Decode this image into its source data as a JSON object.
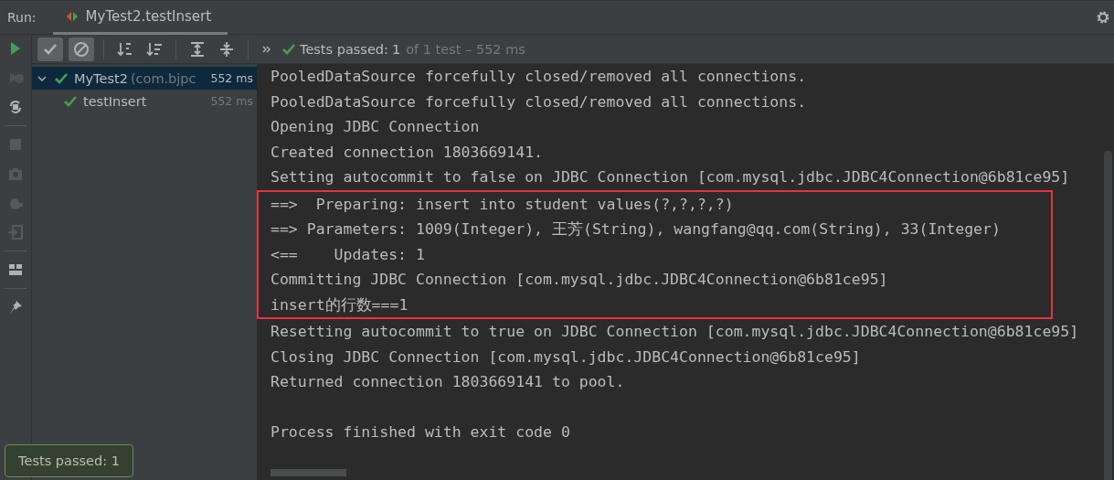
{
  "run_label": "Run:",
  "tab": {
    "title": "MyTest2.testInsert",
    "selected": true
  },
  "toolbar": {
    "toggles": [
      {
        "kind": "passed",
        "selected": true
      },
      {
        "kind": "ignored",
        "selected": true
      }
    ]
  },
  "status": {
    "label": "Tests passed:",
    "count": "1",
    "detail": "of 1 test – 552 ms",
    "passed": true
  },
  "tree": [
    {
      "name": "MyTest2",
      "package": "(com.bjpc",
      "time": "552 ms",
      "selected": true,
      "expanded": true,
      "passed": true,
      "children": [
        {
          "name": "testInsert",
          "time": "552 ms",
          "selected": false,
          "passed": true
        }
      ]
    }
  ],
  "console": [
    {
      "text": "PooledDataSource forcefully closed/removed all connections.",
      "highlighted": false
    },
    {
      "text": "PooledDataSource forcefully closed/removed all connections.",
      "highlighted": false
    },
    {
      "text": "Opening JDBC Connection",
      "highlighted": false
    },
    {
      "text": "Created connection 1803669141.",
      "highlighted": false
    },
    {
      "text": "Setting autocommit to false on JDBC Connection [com.mysql.jdbc.JDBC4Connection@6b81ce95]",
      "highlighted": false
    },
    {
      "text": "==>  Preparing: insert into student values(?,?,?,?)",
      "highlighted": true
    },
    {
      "text": "==> Parameters: 1009(Integer), 王芳(String), wangfang@qq.com(String), 33(Integer)",
      "highlighted": true
    },
    {
      "text": "<==    Updates: 1",
      "highlighted": true
    },
    {
      "text": "Committing JDBC Connection [com.mysql.jdbc.JDBC4Connection@6b81ce95]",
      "highlighted": true
    },
    {
      "text": "insert的行数===1",
      "highlighted": true
    },
    {
      "text": "Resetting autocommit to true on JDBC Connection [com.mysql.jdbc.JDBC4Connection@6b81ce95]",
      "highlighted": false
    },
    {
      "text": "Closing JDBC Connection [com.mysql.jdbc.JDBC4Connection@6b81ce95]",
      "highlighted": false
    },
    {
      "text": "Returned connection 1803669141 to pool.",
      "highlighted": false
    }
  ],
  "exit_message": "Process finished with exit code 0",
  "toast": "Tests passed: 1"
}
